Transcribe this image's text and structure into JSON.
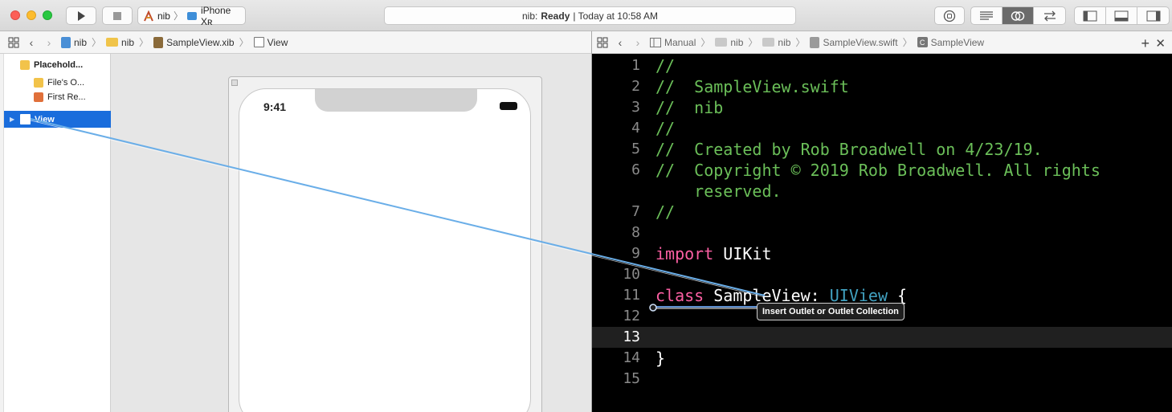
{
  "toolbar": {
    "scheme_project": "nib",
    "scheme_device": "iPhone Xʀ",
    "activity_project": "nib:",
    "activity_status": "Ready",
    "activity_time": "| Today at 10:58 AM"
  },
  "left_jumpbar": {
    "crumbs": [
      "nib",
      "nib",
      "SampleView.xib",
      "View"
    ]
  },
  "right_jumpbar": {
    "crumbs": [
      "Manual",
      "nib",
      "nib",
      "SampleView.swift",
      "SampleView"
    ],
    "class_icon_letter": "C"
  },
  "outline": {
    "section_label": "Placehold...",
    "items": [
      "File's O...",
      "First Re...",
      "View"
    ]
  },
  "canvas": {
    "status_time": "9:41"
  },
  "editor": {
    "lines": [
      {
        "n": "1",
        "segments": [
          {
            "t": "//",
            "c": "com"
          }
        ]
      },
      {
        "n": "2",
        "segments": [
          {
            "t": "//  SampleView.swift",
            "c": "com"
          }
        ]
      },
      {
        "n": "3",
        "segments": [
          {
            "t": "//  nib",
            "c": "com"
          }
        ]
      },
      {
        "n": "4",
        "segments": [
          {
            "t": "//",
            "c": "com"
          }
        ]
      },
      {
        "n": "5",
        "segments": [
          {
            "t": "//  Created by Rob Broadwell on 4/23/19.",
            "c": "com"
          }
        ]
      },
      {
        "n": "6",
        "segments": [
          {
            "t": "//  Copyright © 2019 Rob Broadwell. All rights",
            "c": "com"
          }
        ]
      },
      {
        "n": "",
        "segments": [
          {
            "t": "    reserved.",
            "c": "com"
          }
        ]
      },
      {
        "n": "7",
        "segments": [
          {
            "t": "//",
            "c": "com"
          }
        ]
      },
      {
        "n": "8",
        "segments": []
      },
      {
        "n": "9",
        "segments": [
          {
            "t": "import",
            "c": "kw"
          },
          {
            "t": " UIKit",
            "c": "plain"
          }
        ]
      },
      {
        "n": "10",
        "segments": []
      },
      {
        "n": "11",
        "segments": [
          {
            "t": "class",
            "c": "kw"
          },
          {
            "t": " SampleView: ",
            "c": "plain"
          },
          {
            "t": "UIView",
            "c": "type"
          },
          {
            "t": " {",
            "c": "plain"
          }
        ]
      },
      {
        "n": "12",
        "segments": []
      },
      {
        "n": "13",
        "segments": [],
        "current": true
      },
      {
        "n": "14",
        "segments": [
          {
            "t": "}",
            "c": "plain"
          }
        ]
      },
      {
        "n": "15",
        "segments": []
      }
    ]
  },
  "connection": {
    "tooltip": "Insert Outlet or Outlet Collection"
  },
  "colors": {
    "selection": "#1a6ddc",
    "comment": "#6bbf59",
    "keyword": "#fc5fa3",
    "type": "#41a1c0",
    "connection_line": "#6aaee8"
  }
}
